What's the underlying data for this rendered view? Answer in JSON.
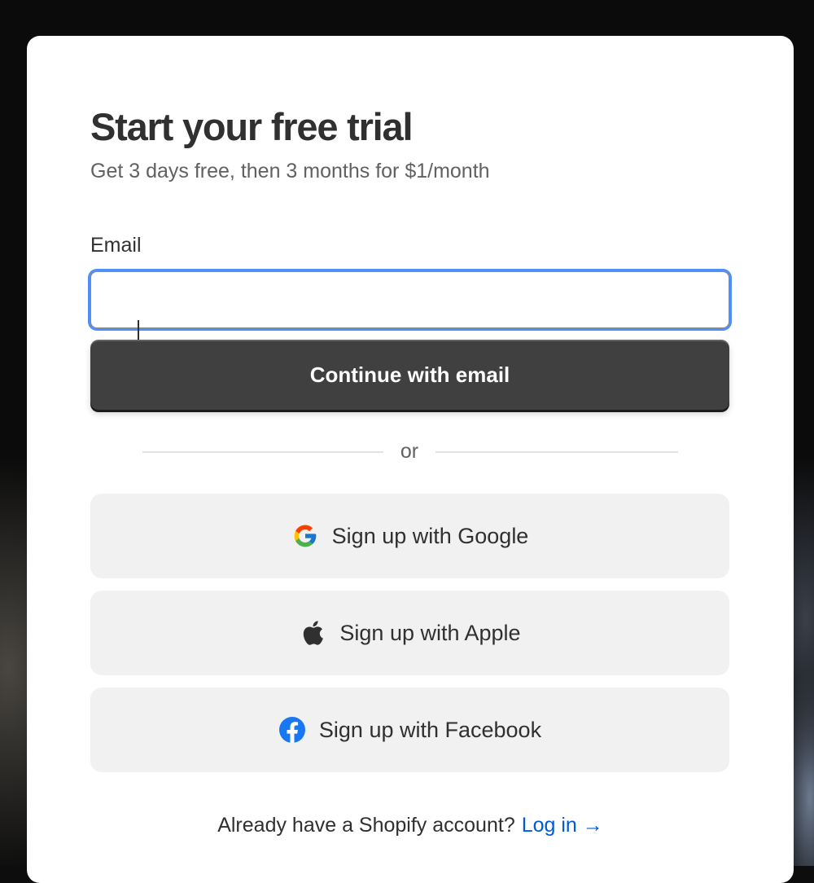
{
  "form": {
    "title": "Start your free trial",
    "subtitle": "Get 3 days free, then 3 months for $1/month",
    "email_label": "Email",
    "email_value": "",
    "continue_label": "Continue with email",
    "divider_text": "or"
  },
  "social": [
    {
      "label": "Sign up with Google",
      "icon": "google-icon"
    },
    {
      "label": "Sign up with Apple",
      "icon": "apple-icon"
    },
    {
      "label": "Sign up with Facebook",
      "icon": "facebook-icon"
    }
  ],
  "footer": {
    "prompt": "Already have a Shopify account?",
    "login_label": "Log in →"
  },
  "colors": {
    "primary_button": "#404040",
    "link": "#005bd3",
    "focus_ring": "#4f8ff7",
    "facebook_blue": "#1877f2"
  }
}
